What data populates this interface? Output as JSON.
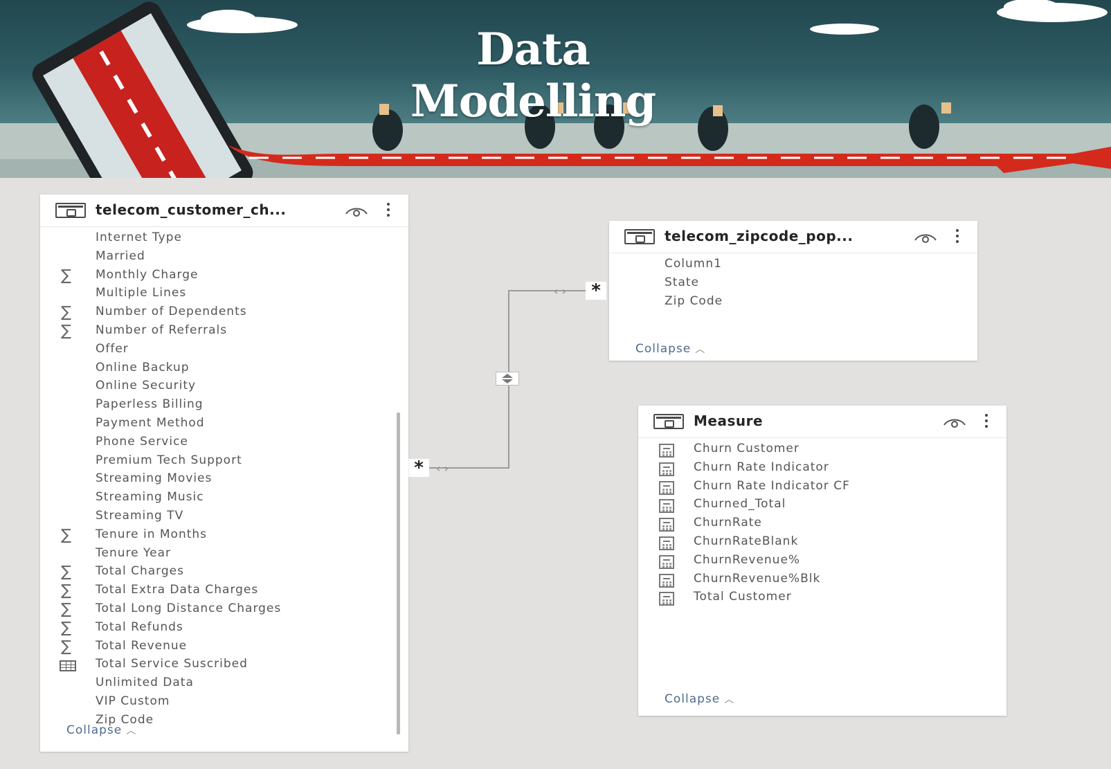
{
  "banner": {
    "title": "Data Modelling"
  },
  "tables": {
    "customer": {
      "title": "telecom_customer_ch...",
      "fields": [
        {
          "label": "Internet Type",
          "icon": "none"
        },
        {
          "label": "Married",
          "icon": "none"
        },
        {
          "label": "Monthly Charge",
          "icon": "sigma"
        },
        {
          "label": "Multiple Lines",
          "icon": "none"
        },
        {
          "label": "Number of Dependents",
          "icon": "sigma"
        },
        {
          "label": "Number of Referrals",
          "icon": "sigma"
        },
        {
          "label": "Offer",
          "icon": "none"
        },
        {
          "label": "Online Backup",
          "icon": "none"
        },
        {
          "label": "Online Security",
          "icon": "none"
        },
        {
          "label": "Paperless Billing",
          "icon": "none"
        },
        {
          "label": "Payment Method",
          "icon": "none"
        },
        {
          "label": "Phone Service",
          "icon": "none"
        },
        {
          "label": "Premium Tech Support",
          "icon": "none"
        },
        {
          "label": "Streaming Movies",
          "icon": "none"
        },
        {
          "label": "Streaming Music",
          "icon": "none"
        },
        {
          "label": "Streaming TV",
          "icon": "none"
        },
        {
          "label": "Tenure in Months",
          "icon": "sigma"
        },
        {
          "label": "Tenure Year",
          "icon": "none"
        },
        {
          "label": "Total Charges",
          "icon": "sigma"
        },
        {
          "label": "Total Extra Data Charges",
          "icon": "sigma"
        },
        {
          "label": "Total Long Distance Charges",
          "icon": "sigma"
        },
        {
          "label": "Total Refunds",
          "icon": "sigma"
        },
        {
          "label": "Total Revenue",
          "icon": "sigma"
        },
        {
          "label": "Total Service Suscribed",
          "icon": "calculated-column"
        },
        {
          "label": "Unlimited Data",
          "icon": "none"
        },
        {
          "label": "VIP Custom",
          "icon": "none"
        },
        {
          "label": "Zip Code",
          "icon": "none"
        }
      ],
      "collapse": "Collapse"
    },
    "zipcode": {
      "title": "telecom_zipcode_pop...",
      "fields": [
        {
          "label": "Column1",
          "icon": "none"
        },
        {
          "label": "State",
          "icon": "none"
        },
        {
          "label": "Zip Code",
          "icon": "none"
        }
      ],
      "collapse": "Collapse"
    },
    "measure": {
      "title": "Measure",
      "fields": [
        {
          "label": "Churn Customer",
          "icon": "measure"
        },
        {
          "label": "Churn Rate Indicator",
          "icon": "measure"
        },
        {
          "label": "Churn Rate Indicator CF",
          "icon": "measure"
        },
        {
          "label": "Churned_Total",
          "icon": "measure"
        },
        {
          "label": "ChurnRate",
          "icon": "measure"
        },
        {
          "label": "ChurnRateBlank",
          "icon": "measure"
        },
        {
          "label": "ChurnRevenue%",
          "icon": "measure"
        },
        {
          "label": "ChurnRevenue%Blk",
          "icon": "measure"
        },
        {
          "label": "Total Customer",
          "icon": "measure"
        }
      ],
      "collapse": "Collapse"
    }
  },
  "relationship": {
    "from_cardinality": "*",
    "to_cardinality": "*",
    "cross_filter": "both"
  },
  "icons": {
    "visibility": "eye-icon",
    "more": "more-options-icon",
    "table": "table-icon"
  }
}
